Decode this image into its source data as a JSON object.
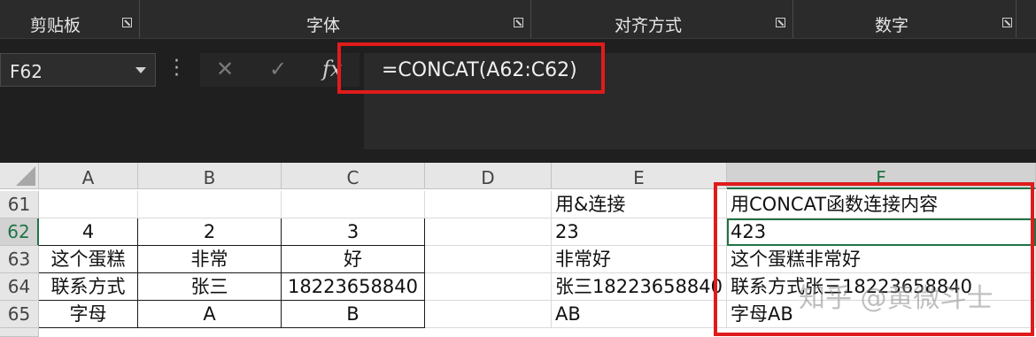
{
  "ribbon": {
    "groups": [
      {
        "label": "剪贴板"
      },
      {
        "label": "字体"
      },
      {
        "label": "对齐方式"
      },
      {
        "label": "数字"
      }
    ]
  },
  "name_box": {
    "value": "F62"
  },
  "formula_bar": {
    "cancel_icon": "x-icon",
    "enter_icon": "check-icon",
    "fx_label": "fx",
    "formula": "=CONCAT(A62:C62)"
  },
  "sheet": {
    "columns": [
      "A",
      "B",
      "C",
      "D",
      "E",
      "F"
    ],
    "selected_column": "F",
    "rows": [
      "61",
      "62",
      "63",
      "64",
      "65"
    ],
    "selected_row": "62",
    "cells": {
      "E61": "用&连接",
      "F61": "用CONCAT函数连接内容",
      "A62": "4",
      "B62": "2",
      "C62": "3",
      "E62": "23",
      "F62": "423",
      "A63": "这个蛋糕",
      "B63": "非常",
      "C63": "好",
      "E63": "非常好",
      "F63": "这个蛋糕非常好",
      "A64": "联系方式",
      "B64": "张三",
      "C64": "18223658840",
      "E64": "张三18223658840",
      "F64": "联系方式张三18223658840",
      "A65": "字母",
      "B65": "A",
      "C65": "B",
      "E65": "AB",
      "F65": "字母AB"
    }
  },
  "watermark": "知乎 @黄微斗士",
  "colors": {
    "highlight": "#e01b1b",
    "excel_green": "#217346",
    "dark_bg": "#1f1f1f"
  }
}
